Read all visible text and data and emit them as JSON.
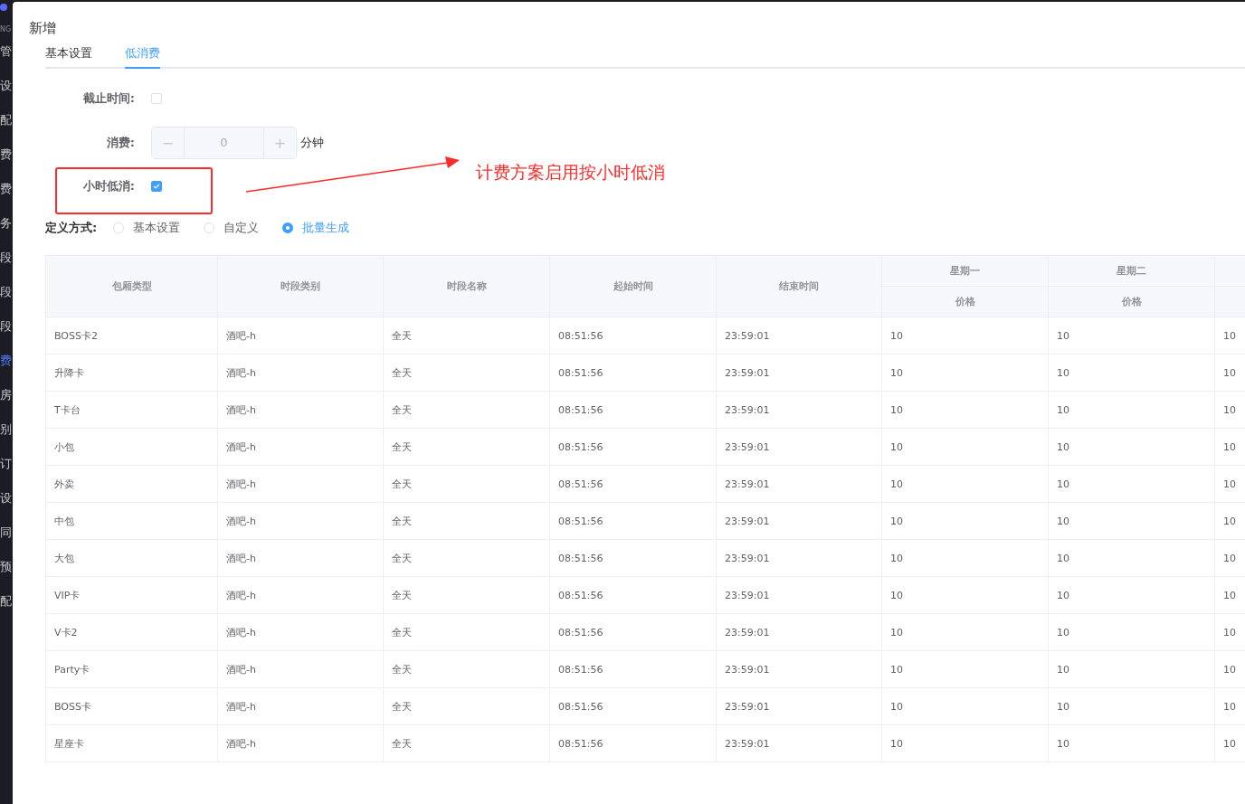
{
  "sidebar": {
    "logo_text": "NG",
    "items": [
      {
        "label": "管",
        "selected": false
      },
      {
        "label": "设",
        "selected": false
      },
      {
        "label": "配",
        "selected": false
      },
      {
        "label": "费",
        "selected": false
      },
      {
        "label": "费",
        "selected": false
      },
      {
        "label": "务",
        "selected": false
      },
      {
        "label": "段",
        "selected": false
      },
      {
        "label": "段",
        "selected": false
      },
      {
        "label": "段",
        "selected": false
      },
      {
        "label": "费",
        "selected": true
      },
      {
        "label": "房",
        "selected": false
      },
      {
        "label": "别",
        "selected": false
      },
      {
        "label": "订",
        "selected": false
      },
      {
        "label": "设",
        "selected": false
      },
      {
        "label": "同",
        "selected": false
      },
      {
        "label": "预",
        "selected": false
      },
      {
        "label": "配",
        "selected": false
      }
    ]
  },
  "dialog": {
    "title": "新增",
    "tabs": [
      {
        "label": "基本设置",
        "selected": false
      },
      {
        "label": "低消费",
        "selected": true
      }
    ],
    "form": [
      {
        "kind": "checkbox",
        "label": "截止时间:",
        "checked": false
      },
      {
        "kind": "number",
        "label": "消费:",
        "minus": "−",
        "plus": "+",
        "value": "0",
        "unit": "分钟"
      },
      {
        "kind": "checkbox",
        "label": "小时低消:",
        "checked": true
      }
    ],
    "mode": {
      "label": "定义方式:",
      "options": [
        {
          "label": "基本设置",
          "selected": false
        },
        {
          "label": "自定义",
          "selected": false
        },
        {
          "label": "批量生成",
          "selected": true
        }
      ]
    },
    "table": {
      "columns": [
        "包厢类型",
        "时段类别",
        "时段名称",
        "起始时间",
        "结束时间"
      ],
      "day_groups": [
        {
          "kind": "day",
          "label": "星期一",
          "sub": "价格"
        },
        {
          "kind": "day",
          "label": "星期二",
          "sub": "价格"
        },
        {
          "kind": "blank"
        }
      ],
      "rows": [
        {
          "cells": [
            "BOSS卡2",
            "酒吧-h",
            "全天",
            "08:51:56",
            "23:59:01"
          ],
          "prices": [
            "10",
            "10",
            "10"
          ]
        },
        {
          "cells": [
            "升降卡",
            "酒吧-h",
            "全天",
            "08:51:56",
            "23:59:01"
          ],
          "prices": [
            "10",
            "10",
            "10"
          ]
        },
        {
          "cells": [
            "T卡台",
            "酒吧-h",
            "全天",
            "08:51:56",
            "23:59:01"
          ],
          "prices": [
            "10",
            "10",
            "10"
          ]
        },
        {
          "cells": [
            "小包",
            "酒吧-h",
            "全天",
            "08:51:56",
            "23:59:01"
          ],
          "prices": [
            "10",
            "10",
            "10"
          ]
        },
        {
          "cells": [
            "外卖",
            "酒吧-h",
            "全天",
            "08:51:56",
            "23:59:01"
          ],
          "prices": [
            "10",
            "10",
            "10"
          ]
        },
        {
          "cells": [
            "中包",
            "酒吧-h",
            "全天",
            "08:51:56",
            "23:59:01"
          ],
          "prices": [
            "10",
            "10",
            "10"
          ]
        },
        {
          "cells": [
            "大包",
            "酒吧-h",
            "全天",
            "08:51:56",
            "23:59:01"
          ],
          "prices": [
            "10",
            "10",
            "10"
          ]
        },
        {
          "cells": [
            "VIP卡",
            "酒吧-h",
            "全天",
            "08:51:56",
            "23:59:01"
          ],
          "prices": [
            "10",
            "10",
            "10"
          ]
        },
        {
          "cells": [
            "V卡2",
            "酒吧-h",
            "全天",
            "08:51:56",
            "23:59:01"
          ],
          "prices": [
            "10",
            "10",
            "10"
          ]
        },
        {
          "cells": [
            "Party卡",
            "酒吧-h",
            "全天",
            "08:51:56",
            "23:59:01"
          ],
          "prices": [
            "10",
            "10",
            "10"
          ]
        },
        {
          "cells": [
            "BOSS卡",
            "酒吧-h",
            "全天",
            "08:51:56",
            "23:59:01"
          ],
          "prices": [
            "10",
            "10",
            "10"
          ]
        },
        {
          "cells": [
            "星座卡",
            "酒吧-h",
            "全天",
            "08:51:56",
            "23:59:01"
          ],
          "prices": [
            "10",
            "10",
            "10"
          ]
        }
      ]
    }
  },
  "annotation": {
    "text": "计费方案启用按小时低消"
  }
}
